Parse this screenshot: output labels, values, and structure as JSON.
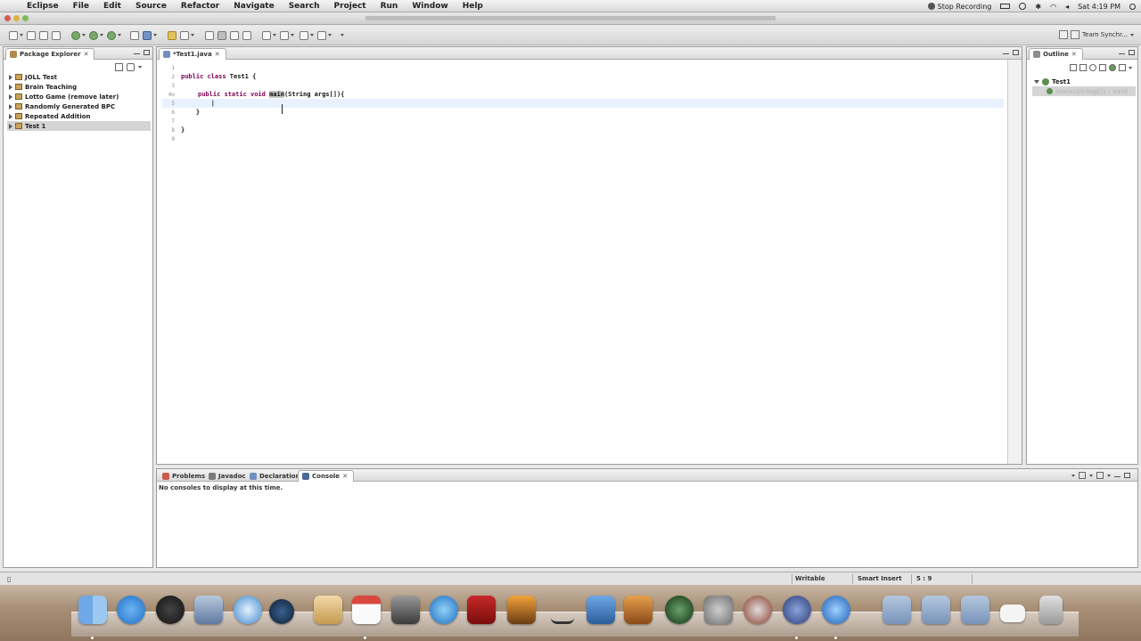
{
  "menubar": {
    "items": [
      "Eclipse",
      "File",
      "Edit",
      "Source",
      "Refactor",
      "Navigate",
      "Search",
      "Project",
      "Run",
      "Window",
      "Help"
    ],
    "status": "Stop Recording",
    "clock": "Sat 4:19 PM"
  },
  "toolbar": {
    "perspective_label": "Team Synchr..."
  },
  "package_explorer": {
    "tab_label": "Package Explorer",
    "items": [
      {
        "label": "JOLL Test"
      },
      {
        "label": "Brain Teaching"
      },
      {
        "label": "Lotto Game (remove later)"
      },
      {
        "label": "Randomly Generated BPC"
      },
      {
        "label": "Repeated Addition"
      },
      {
        "label": "Test 1"
      }
    ]
  },
  "editor": {
    "tab_label": "*Test1.java",
    "lines": [
      {
        "num": "1",
        "text": ""
      },
      {
        "num": "2",
        "kw": "public class",
        "text": " Test1 {"
      },
      {
        "num": "3",
        "text": ""
      },
      {
        "num": "4⊖",
        "kw": "public static void",
        "hl": "main",
        "text": "(String args[]){"
      },
      {
        "num": "5",
        "text": "        |"
      },
      {
        "num": "6",
        "text": "    }"
      },
      {
        "num": "7",
        "text": ""
      },
      {
        "num": "8",
        "text": "}"
      },
      {
        "num": "9",
        "text": ""
      }
    ]
  },
  "outline": {
    "tab_label": "Outline",
    "items": [
      {
        "label": "Test1"
      },
      {
        "label": "main(String[]) : void"
      }
    ]
  },
  "bottom_panel": {
    "tabs": [
      "Problems",
      "Javadoc",
      "Declaration",
      "Console"
    ],
    "message": "No consoles to display at this time."
  },
  "statusbar": {
    "writable": "Writable",
    "insert_mode": "Smart Insert",
    "position": "5 : 9"
  },
  "colors": {
    "accent": "#7f0055",
    "current_line": "#e8f2fe"
  },
  "dock": {
    "icons": [
      "finder-icon",
      "app-store-icon",
      "dashboard-icon",
      "preview-icon",
      "safari-icon",
      "iphoto-camera-icon",
      "address-book-icon",
      "ical-icon",
      "photo-booth-icon",
      "itunes-icon",
      "photo-icon",
      "image-icon",
      "sidewinder-icon",
      "xcode-icon",
      "garageband-icon",
      "time-machine-icon",
      "system-preferences-icon",
      "dvd-icon",
      "eclipse-icon",
      "quicktime-icon",
      "applications-folder-icon",
      "documents-folder-icon",
      "downloads-folder-icon",
      "screenshot-icon",
      "trash-icon"
    ]
  }
}
